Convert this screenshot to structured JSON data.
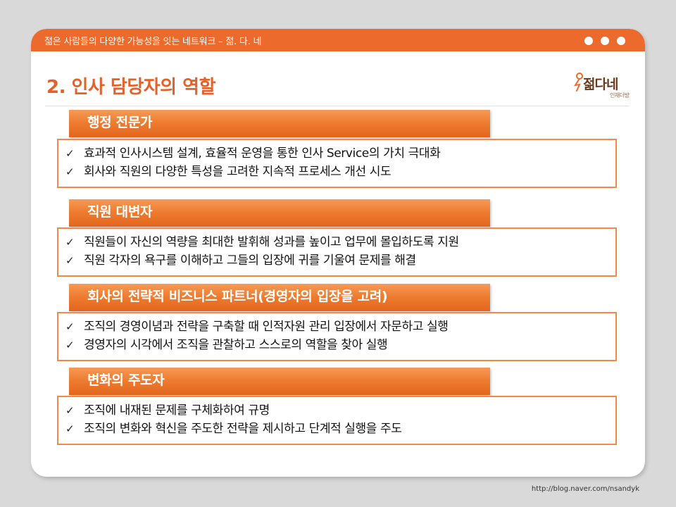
{
  "header": {
    "tagline": "젊은 사람들의 다양한 가능성을 잇는 네트워크 – 젊. 다. 네",
    "window_dots": [
      "dot",
      "dot",
      "dot"
    ]
  },
  "title": "2. 인사 담당자의 역할",
  "logo": {
    "text": "젊다네",
    "subtitle": "인재더방"
  },
  "sections": [
    {
      "header": "행정 전문가",
      "bullets": [
        "효과적 인사시스템 설계, 효율적 운영을 통한 인사 Service의 가치 극대화",
        "회사와 직원의 다양한 특성을 고려한 지속적 프로세스 개선 시도"
      ]
    },
    {
      "header": "직원 대변자",
      "bullets": [
        "직원들이 자신의 역량을 최대한 발휘해 성과를 높이고 업무에 몰입하도록 지원",
        "직원 각자의 욕구를 이해하고 그들의 입장에 귀를 기울여 문제를 해결"
      ]
    },
    {
      "header": "회사의 전략적 비즈니스 파트너(경영자의 입장을 고려)",
      "bullets": [
        "조직의 경영이념과 전략을 구축할 때 인적자원 관리 입장에서 자문하고 실행",
        "경영자의 시각에서 조직을 관찰하고 스스로의 역할을 찾아 실행"
      ]
    },
    {
      "header": "변화의 주도자",
      "bullets": [
        "조직에 내재된 문제를 구체화하여 규명",
        "조직의 변화와 혁신을 주도한 전략을 제시하고 단계적 실행을 주도"
      ]
    }
  ],
  "check_mark": "✓",
  "footer_url": "http://blog.naver.com/nsandyk",
  "colors": {
    "accent": "#ec6a2b",
    "title": "#e4612a",
    "box_border": "#f08a45",
    "background": "#d9d9d9"
  }
}
